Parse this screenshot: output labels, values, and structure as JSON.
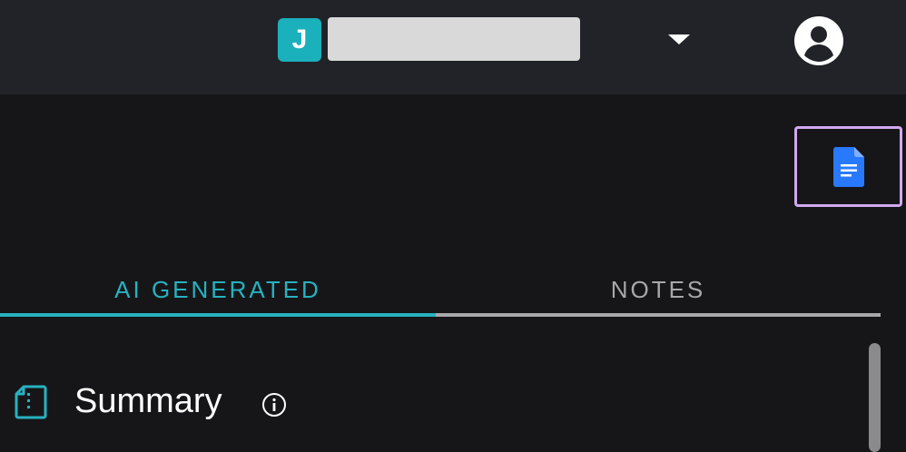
{
  "header": {
    "workspace_initial": "J",
    "workspace_name": "",
    "dropdown_icon": "caret-down-icon",
    "user_icon": "account-circle-icon"
  },
  "toolbar": {
    "doc_icon": "google-docs-icon",
    "doc_button_border_color": "#d1a8f0",
    "doc_icon_color": "#2979ff"
  },
  "tabs": [
    {
      "label": "AI GENERATED",
      "active": true
    },
    {
      "label": "NOTES",
      "active": false
    }
  ],
  "colors": {
    "accent": "#26b2c0",
    "background": "#161618",
    "header_background": "#222328"
  },
  "section": {
    "title": "Summary",
    "icon": "document-outline-icon",
    "info_icon": "info-icon"
  }
}
